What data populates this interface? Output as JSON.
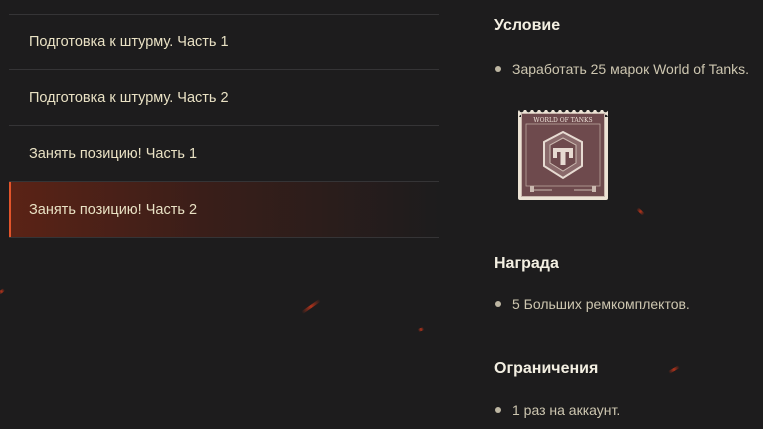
{
  "missions": [
    {
      "label": "Подготовка к штурму. Часть 1",
      "active": false
    },
    {
      "label": "Подготовка к штурму. Часть 2",
      "active": false
    },
    {
      "label": "Занять позицию! Часть 1",
      "active": false
    },
    {
      "label": "Занять позицию! Часть 2",
      "active": true
    }
  ],
  "details": {
    "condition": {
      "title": "Условие",
      "items": [
        "Заработать 25 марок World of Tanks."
      ],
      "stamp": {
        "text": "WORLD OF TANKS",
        "icon": "world-of-tanks-stamp-icon"
      }
    },
    "reward": {
      "title": "Награда",
      "items": [
        "5 Больших ремкомплектов."
      ]
    },
    "limits": {
      "title": "Ограничения",
      "items": [
        "1 раз на аккаунт."
      ]
    }
  },
  "colors": {
    "background": "#1d1c1d",
    "accent": "#e2542a",
    "text": "#e9e1c4"
  }
}
